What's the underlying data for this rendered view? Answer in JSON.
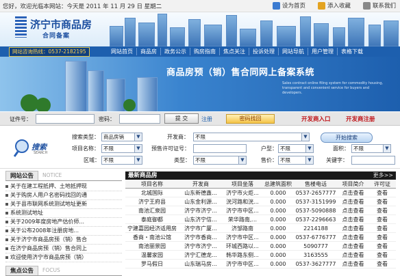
{
  "topbar": {
    "welcome": "您好，欢迎光临本网站：今天是 2011 年 11 月 29 日 星期二",
    "links": [
      "设为首页",
      "添入收藏",
      "联系我们"
    ]
  },
  "header": {
    "title": "济宁市商品房",
    "subtitle": "合同备案"
  },
  "nav": {
    "hotline": "网站咨询热线：0537-2182195",
    "items": [
      "网站首页",
      "商品房",
      "政务公示",
      "购房指南",
      "焦点关注",
      "投诉处理",
      "网站导航",
      "用户管理",
      "表格下载"
    ]
  },
  "banner": {
    "title": "商品房预（销）售合同网上备案系统",
    "subtext": "Sales contract online filing system for commodity housing, transparent and convenient service for buyers and developers."
  },
  "login": {
    "id_label": "证件号：",
    "pw_label": "密码：",
    "submit": "提 交",
    "register": "注册",
    "find_pw": "密码找回",
    "dev_entry": "开发商入口",
    "dev_register": "开发商注册"
  },
  "search": {
    "logo_text": "搜索",
    "logo_sub": "SEARCH",
    "type_label": "搜索类型：",
    "type_value": "商品房销",
    "dev_label": "开发商：",
    "dev_value": "不限",
    "start": "开始搜索",
    "name_label": "项目名称：",
    "name_value": "不限",
    "permit_label": "预售许可证号：",
    "room_label": "户型：",
    "room_value": "不限",
    "area_label": "面积：",
    "area_value": "不限",
    "region_label": "区域：",
    "region_value": "不限",
    "kind_label": "类型：",
    "kind_value": "不限",
    "price_label": "售价：",
    "price_value": "不限",
    "keyword_label": "关键字："
  },
  "announcements": {
    "tab_active": "网站公告",
    "tab_inactive": "NOTICE",
    "items": [
      "关于在建工程抵押、土地抵押现",
      "关于购房人用户名密码找回的通",
      "关于县市联网系统测试地址更新",
      "系统测试地址",
      "关于2009年度房地产估价师...",
      "关于公布2008年注册房地...",
      "关于济宁市商品房预（销）售合",
      "在济宁商品房预（销）售合同上",
      "欢迎使用济宁市商品房预（销）"
    ]
  },
  "focus": {
    "tab_active": "焦点公告",
    "tab_inactive": "FOCUS"
  },
  "listing": {
    "title": "最新商品房",
    "more": "更多>>",
    "columns": [
      "项目名称",
      "开发商",
      "项目坐落",
      "总建筑面积",
      "售楼电话",
      "项目简介",
      "许可证"
    ],
    "rows": [
      [
        "北城国际",
        "山东新德鑫...",
        "济宁市火炬...",
        "0.000",
        "0537-2657777",
        "点击查看",
        "查看"
      ],
      [
        "济宁王府县",
        "山东金利源...",
        "洸河路和洸...",
        "0.000",
        "0537-3151999",
        "点击查看",
        "查看"
      ],
      [
        "南池汇泉园",
        "济宁市济宁...",
        "济宁市中区...",
        "0.000",
        "0537-5090888",
        "点击查看",
        "查看"
      ],
      [
        "泰庭御都",
        "山东济宁信...",
        "荣华路南,...",
        "0.000",
        "0537-2296663",
        "点击查看",
        "查看"
      ],
      [
        "宁建嘉园经济适用房",
        "济宁市广厦...",
        "济邹路南",
        "0.000",
        "2214188",
        "点击查看",
        "查看"
      ],
      [
        "香商・南池公馆",
        "济宁市香商...",
        "济宁市中区...",
        "0.000",
        "0537-6776777",
        "点击查看",
        "查看"
      ],
      [
        "南池丽景园",
        "济宁市济宁...",
        "环城西路以...",
        "0.000",
        "5090777",
        "点击查看",
        "查看"
      ],
      [
        "温馨家园",
        "济宁汇德龙...",
        "韩华路东侧...",
        "0.000",
        "3163555",
        "点击查看",
        "查看"
      ],
      [
        "罗马假日",
        "山东瑞马房...",
        "济宁市中区...",
        "0.000",
        "0537-3627777",
        "点击查看",
        "查看"
      ]
    ]
  },
  "colors": {
    "nav_blue": "#1d5fae",
    "brand_blue": "#1c4fa0",
    "alert_red": "#c0151a"
  }
}
